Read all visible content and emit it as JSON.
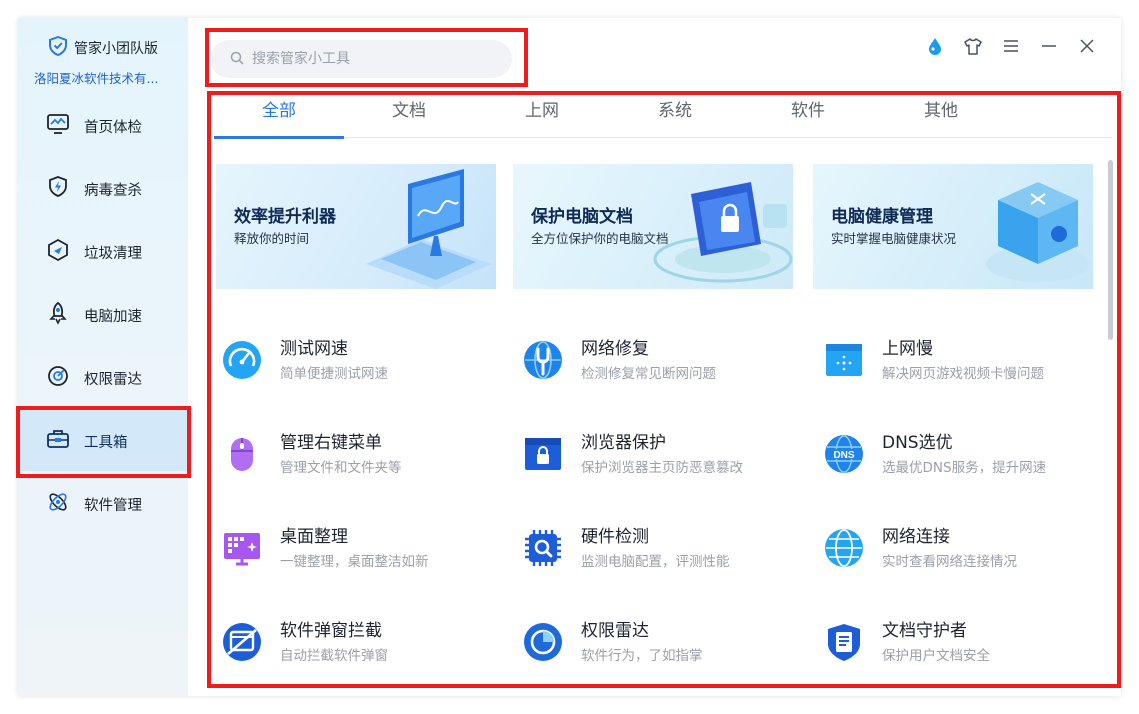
{
  "brand": {
    "name": "管家小团队版",
    "org": "洛阳夏冰软件技术有..."
  },
  "nav": [
    {
      "label": "首页体检",
      "icon": "monitor-icon",
      "active": false
    },
    {
      "label": "病毒查杀",
      "icon": "shield-bolt-icon",
      "active": false
    },
    {
      "label": "垃圾清理",
      "icon": "broom-icon",
      "active": false
    },
    {
      "label": "电脑加速",
      "icon": "rocket-icon",
      "active": false
    },
    {
      "label": "权限雷达",
      "icon": "radar-icon",
      "active": false
    },
    {
      "label": "工具箱",
      "icon": "toolbox-icon",
      "active": true
    },
    {
      "label": "软件管理",
      "icon": "apps-icon",
      "active": false
    }
  ],
  "search": {
    "placeholder": "搜索管家小工具"
  },
  "window_controls": [
    "water-drop-icon",
    "skin-shirt-icon",
    "menu-icon",
    "minimize-icon",
    "close-icon"
  ],
  "tabs": [
    {
      "label": "全部",
      "active": true
    },
    {
      "label": "文档",
      "active": false
    },
    {
      "label": "上网",
      "active": false
    },
    {
      "label": "系统",
      "active": false
    },
    {
      "label": "软件",
      "active": false
    },
    {
      "label": "其他",
      "active": false
    }
  ],
  "banners": [
    {
      "title": "效率提升利器",
      "subtitle": "释放你的时间"
    },
    {
      "title": "保护电脑文档",
      "subtitle": "全方位保护你的电脑文档"
    },
    {
      "title": "电脑健康管理",
      "subtitle": "实时掌握电脑健康状况"
    }
  ],
  "tools": [
    {
      "name": "测试网速",
      "desc": "简单便捷测试网速",
      "icon": "speedometer-icon"
    },
    {
      "name": "网络修复",
      "desc": "检测修复常见断网问题",
      "icon": "wrench-globe-icon"
    },
    {
      "name": "上网慢",
      "desc": "解决网页游戏视频卡慢问题",
      "icon": "browser-loading-icon"
    },
    {
      "name": "管理右键菜单",
      "desc": "管理文件和文件夹等",
      "icon": "mouse-icon"
    },
    {
      "name": "浏览器保护",
      "desc": "保护浏览器主页防恶意篡改",
      "icon": "browser-lock-icon"
    },
    {
      "name": "DNS选优",
      "desc": "选最优DNS服务，提升网速",
      "icon": "dns-globe-icon"
    },
    {
      "name": "桌面整理",
      "desc": "一键整理，桌面整洁如新",
      "icon": "desktop-tidy-icon"
    },
    {
      "name": "硬件检测",
      "desc": "监测电脑配置，评测性能",
      "icon": "chip-search-icon"
    },
    {
      "name": "网络连接",
      "desc": "实时查看网络连接情况",
      "icon": "globe-icon"
    },
    {
      "name": "软件弹窗拦截",
      "desc": "自动拦截软件弹窗",
      "icon": "popup-block-icon"
    },
    {
      "name": "权限雷达",
      "desc": "软件行为，了如指掌",
      "icon": "radar-pie-icon"
    },
    {
      "name": "文档守护者",
      "desc": "保护用户文档安全",
      "icon": "document-shield-icon"
    }
  ]
}
